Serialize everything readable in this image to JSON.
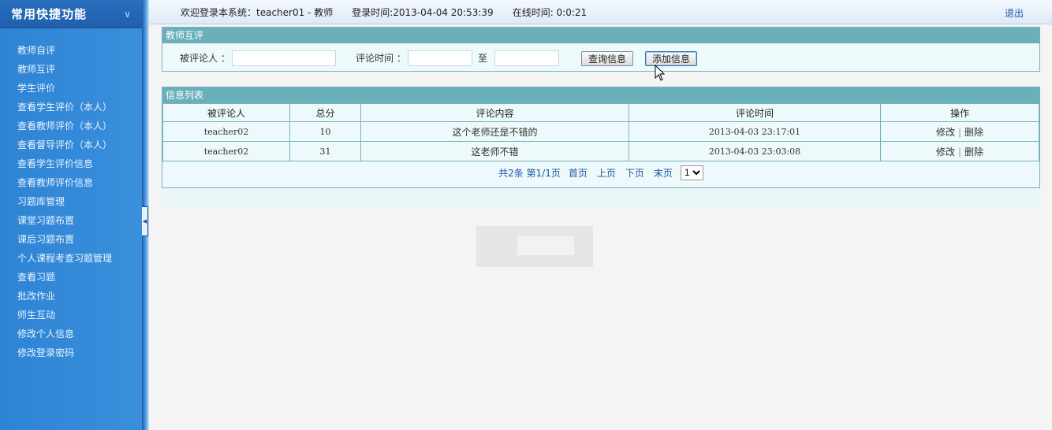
{
  "sidebar": {
    "title": "常用快捷功能",
    "collapse_icon": "double-chevron-down-icon",
    "items": [
      {
        "label": "教师自评"
      },
      {
        "label": "教师互评"
      },
      {
        "label": "学生评价"
      },
      {
        "label": "查看学生评价（本人）"
      },
      {
        "label": "查看教师评价（本人）"
      },
      {
        "label": "查看督导评价（本人）"
      },
      {
        "label": "查看学生评价信息"
      },
      {
        "label": "查看教师评价信息"
      },
      {
        "label": "习题库管理"
      },
      {
        "label": "课堂习题布置"
      },
      {
        "label": "课后习题布置"
      },
      {
        "label": "个人课程考查习题管理"
      },
      {
        "label": "查看习题"
      },
      {
        "label": "批改作业"
      },
      {
        "label": "师生互动"
      },
      {
        "label": "修改个人信息"
      },
      {
        "label": "修改登录密码"
      }
    ]
  },
  "topbar": {
    "welcome": "欢迎登录本系统：teacher01 - 教师",
    "login_time": "登录时间:2013-04-04 20:53:39",
    "online_time": "在线时间: 0:0:21",
    "logout": "退出"
  },
  "search": {
    "panel_title": "教师互评",
    "evaluatee_label": "被评论人 ：",
    "evaluatee_value": "",
    "time_label": "评论时间 ：",
    "time_from_value": "",
    "to_label": "至",
    "time_to_value": "",
    "query_button": "查询信息",
    "add_button": "添加信息"
  },
  "list": {
    "panel_title": "信息列表",
    "columns": [
      "被评论人",
      "总分",
      "评论内容",
      "评论时间",
      "操作"
    ],
    "rows": [
      {
        "evaluatee": "teacher02",
        "score": "10",
        "content": "这个老师还是不错的",
        "time": "2013-04-03 23:17:01",
        "edit": "修改",
        "sep": "|",
        "delete": "删除"
      },
      {
        "evaluatee": "teacher02",
        "score": "31",
        "content": "这老师不错",
        "time": "2013-04-03 23:03:08",
        "edit": "修改",
        "sep": "|",
        "delete": "删除"
      }
    ],
    "pager": {
      "info": "共2条 第1/1页",
      "first": "首页",
      "prev": "上页",
      "next": "下页",
      "last": "末页",
      "page_select": "1"
    }
  }
}
